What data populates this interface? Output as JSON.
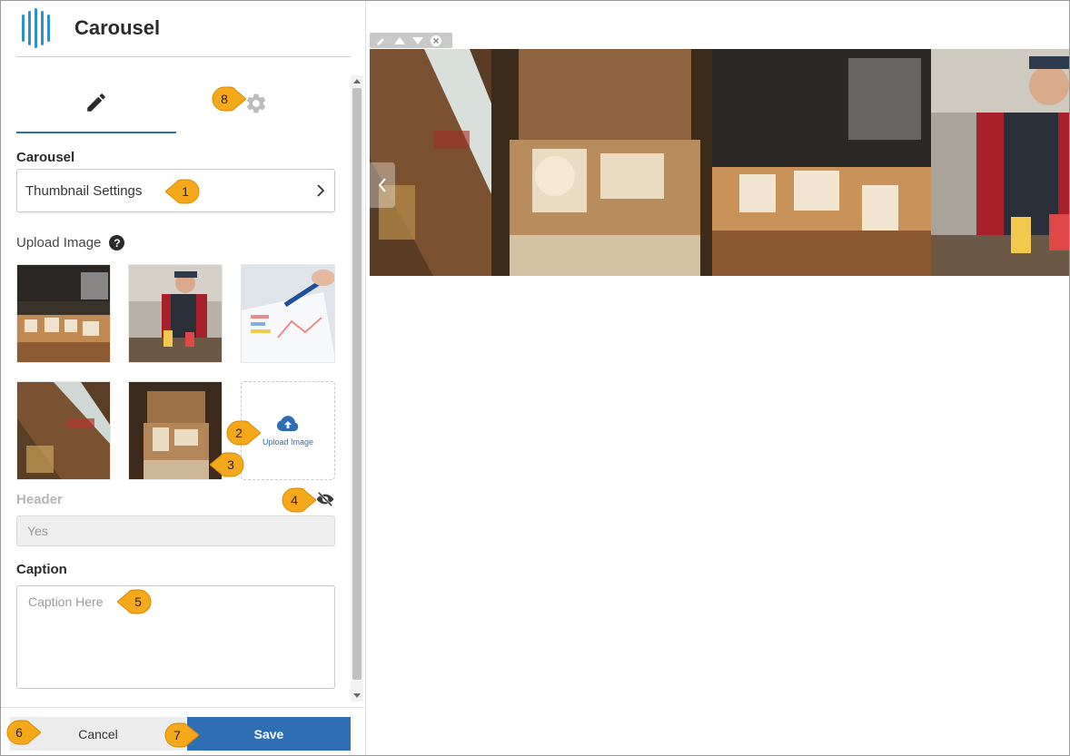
{
  "panel": {
    "title": "Carousel",
    "tabs": [
      {
        "name": "edit",
        "icon": "pencil-icon"
      },
      {
        "name": "settings",
        "icon": "gear-icon"
      }
    ],
    "section_title": "Carousel",
    "thumbnail_settings_label": "Thumbnail Settings",
    "upload_image_label": "Upload Image",
    "help_icon": "?",
    "upload_tile_label": "Upload Image",
    "images": [
      {
        "name": "shelf-signs-photo"
      },
      {
        "name": "bartender-photo"
      },
      {
        "name": "chart-drawing-photo"
      },
      {
        "name": "store-aisle-photo"
      },
      {
        "name": "vintage-box-photo"
      }
    ],
    "header": {
      "label": "Header",
      "value": "Yes"
    },
    "caption": {
      "label": "Caption",
      "placeholder": "Caption Here",
      "value": ""
    },
    "cancel_label": "Cancel",
    "save_label": "Save"
  },
  "callouts": [
    "1",
    "2",
    "3",
    "4",
    "5",
    "6",
    "7",
    "8"
  ],
  "colors": {
    "accent": "#2e6fb4",
    "logo": "#2a8fd3",
    "callout": "#f5a91a"
  }
}
